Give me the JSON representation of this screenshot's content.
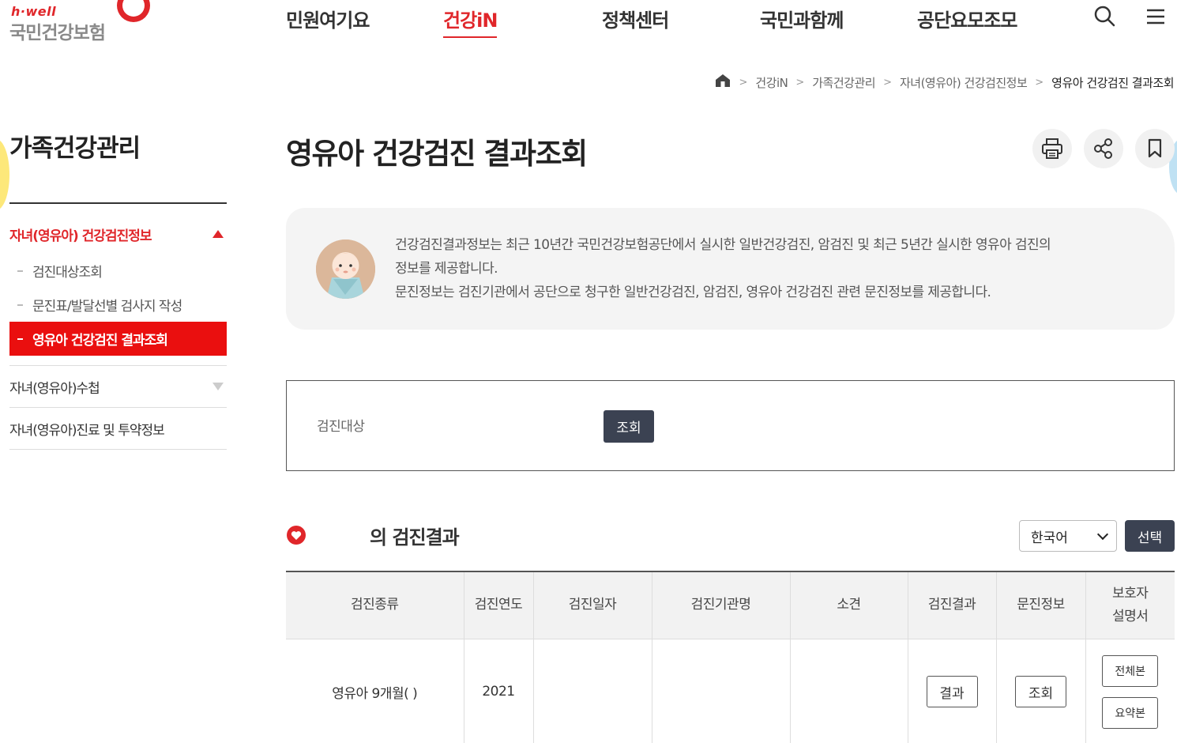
{
  "header": {
    "brand_small": "h·well",
    "brand_name": "국민건강보험",
    "nav": [
      "민원여기요",
      "건강iN",
      "정책센터",
      "국민과함께",
      "공단요모조모"
    ],
    "active_nav": 1
  },
  "breadcrumb": [
    "건강iN",
    "가족건강관리",
    "자녀(영유아) 건강검진정보",
    "영유아 건강검진 결과조회"
  ],
  "sidebar": {
    "title": "가족건강관리",
    "sections": [
      {
        "label": "자녀(영유아) 건강검진정보",
        "children": [
          "검진대상조회",
          "문진표/발달선별 검사지 작성",
          "영유아 건강검진 결과조회"
        ]
      },
      {
        "label": "자녀(영유아)수첩"
      },
      {
        "label": "자녀(영유아)진료 및 투약정보"
      }
    ]
  },
  "page": {
    "title": "영유아 건강검진 결과조회"
  },
  "info": {
    "line1": "건강검진결과정보는 최근 10년간 국민건강보험공단에서 실시한 일반건강검진, 암검진 및 최근 5년간 실시한 영유아 검진의",
    "line2": "정보를 제공합니다.",
    "line3": "문진정보는 검진기관에서 공단으로 청구한 일반건강검진, 암검진, 영유아 건강검진 관련 문진정보를 제공합니다."
  },
  "search": {
    "label": "검진대상",
    "button": "조회"
  },
  "results": {
    "title": "의 검진결과",
    "language": "한국어",
    "select_button": "선택",
    "columns": [
      "검진종류",
      "검진연도",
      "검진일자",
      "검진기관명",
      "소견",
      "검진결과",
      "문진정보"
    ],
    "col_last_line1": "보호자",
    "col_last_line2": "설명서",
    "rows": [
      {
        "type": "영유아 9개월(       )",
        "year": "2021",
        "date": "",
        "institution": "",
        "opinion": "",
        "result_btn": "결과",
        "inquiry_btn": "조회",
        "guide_full": "전체본",
        "guide_summary": "요약본"
      }
    ]
  },
  "colors": {
    "accent": "#e0262a",
    "active_menu_bg": "#ea0f0f",
    "dark_button": "#3b4252"
  }
}
